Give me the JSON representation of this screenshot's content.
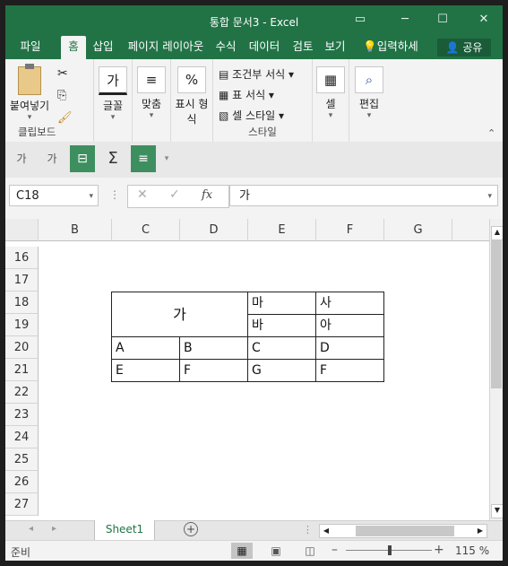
{
  "window": {
    "title": "통합 문서3 - Excel",
    "controls": [
      "─",
      "☐",
      "✕"
    ]
  },
  "tabs": [
    "파일",
    "홈",
    "삽입",
    "페이지 레이아웃",
    "수식",
    "데이터",
    "검토",
    "보기",
    "입력하세요",
    "공유"
  ],
  "ribbon": {
    "clipboard": {
      "paste": "붙여넣기",
      "group": "클립보드"
    },
    "font": {
      "label": "글꼴",
      "icon_text": "가"
    },
    "align": {
      "label": "맞춤"
    },
    "number": {
      "label1": "표시 형",
      "label2": "식",
      "icon_text": "%"
    },
    "styles": {
      "cond": "조건부 서식",
      "table": "표 서식",
      "cell": "셀 스타일",
      "group": "스타일"
    },
    "cells": {
      "label": "셀"
    },
    "edit": {
      "label": "편집"
    }
  },
  "qat": {
    "inc_font": "가",
    "dec_font": "가",
    "sum": "Σ"
  },
  "formula_bar": {
    "name_box": "C18",
    "fx": "fx",
    "value": "가"
  },
  "columns": [
    "B",
    "C",
    "D",
    "E",
    "F",
    "G"
  ],
  "rows": [
    "16",
    "17",
    "18",
    "19",
    "20",
    "21",
    "22",
    "23",
    "24",
    "25",
    "26",
    "27"
  ],
  "cells": {
    "merged": "가",
    "e18": "마",
    "f18": "사",
    "e19": "바",
    "f19": "아",
    "c20": "A",
    "d20": "B",
    "e20": "C",
    "f20": "D",
    "c21": "E",
    "d21": "F",
    "e21": "G",
    "f21": "F"
  },
  "sheet_tab": "Sheet1",
  "status": {
    "mode": "준비",
    "zoom": "115 %"
  }
}
